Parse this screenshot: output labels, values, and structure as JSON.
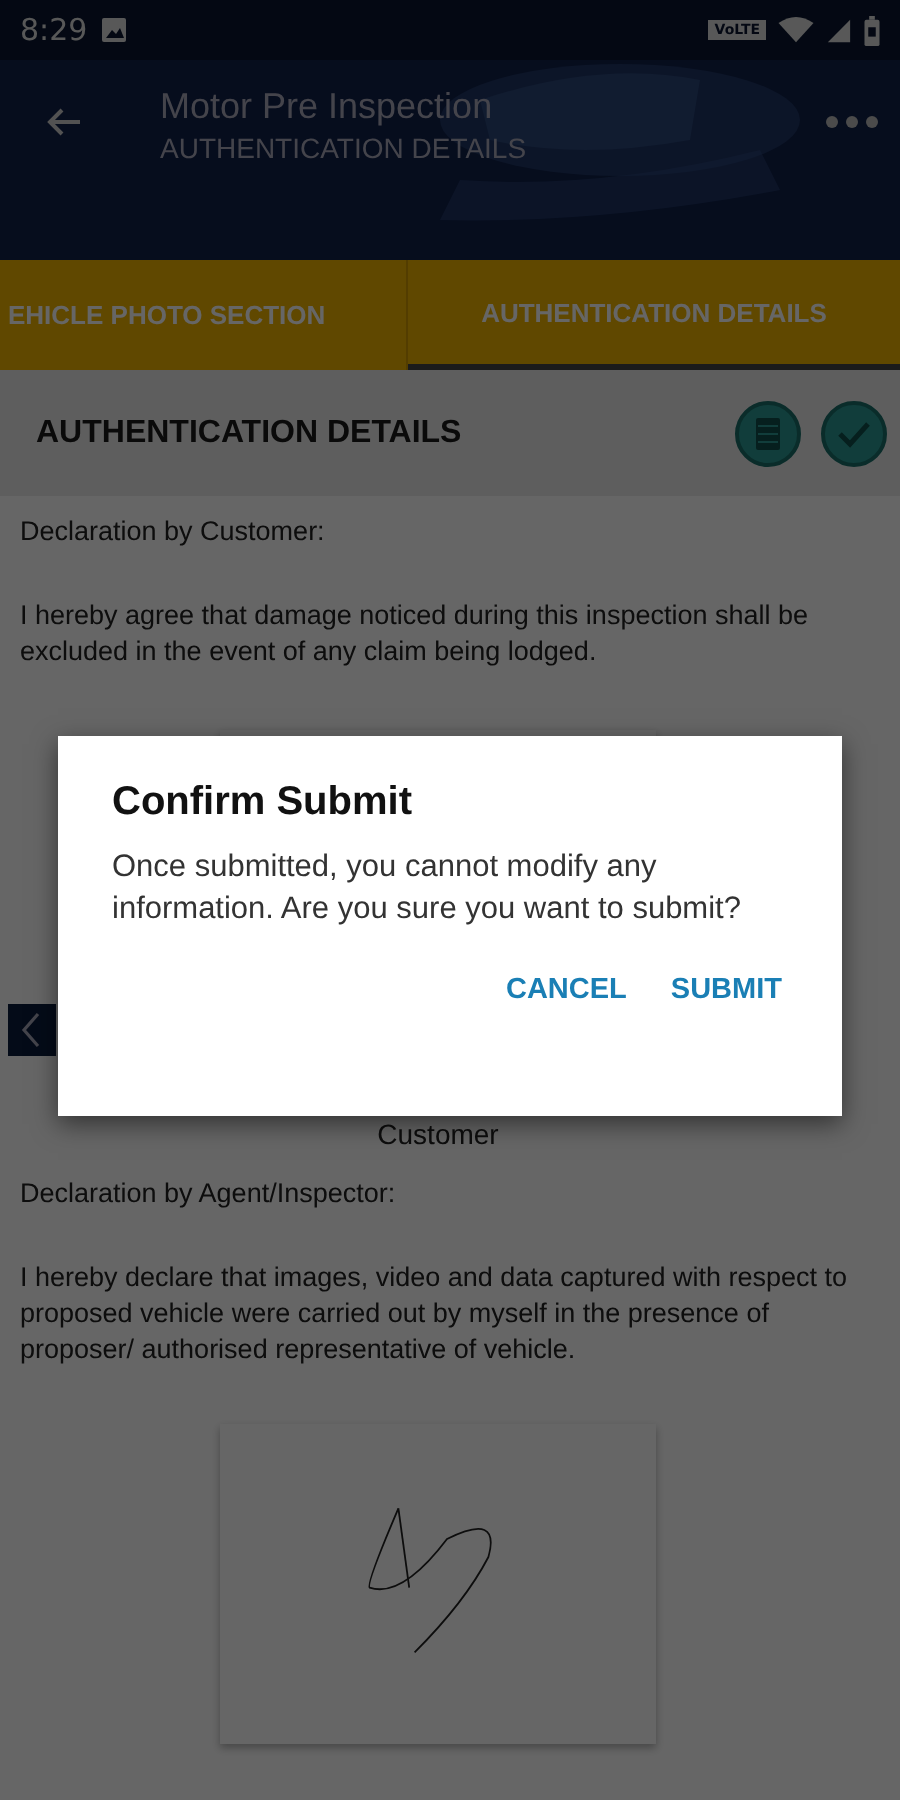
{
  "status_bar": {
    "time": "8:29",
    "network_badge": "VoLTE"
  },
  "app_bar": {
    "title": "Motor Pre Inspection",
    "subtitle": "AUTHENTICATION DETAILS"
  },
  "tabs": [
    {
      "label": "EHICLE PHOTO SECTION",
      "selected": false
    },
    {
      "label": "AUTHENTICATION DETAILS",
      "selected": true
    }
  ],
  "section": {
    "title": "AUTHENTICATION DETAILS"
  },
  "declarations": [
    {
      "heading": "Declaration by Customer:",
      "text": "I hereby agree that damage noticed during this inspection shall be excluded in the event of any claim being lodged.",
      "signature_label": "Customer"
    },
    {
      "heading": "Declaration by Agent/Inspector:",
      "text": "I hereby declare that images, video and data captured with respect to proposed vehicle were carried out by myself in the presence of proposer/ authorised representative of vehicle.",
      "signed": true
    }
  ],
  "dialog": {
    "title": "Confirm Submit",
    "message": "Once submitted, you cannot modify any information. Are you sure you want to submit?",
    "buttons": [
      "CANCEL",
      "SUBMIT"
    ]
  }
}
